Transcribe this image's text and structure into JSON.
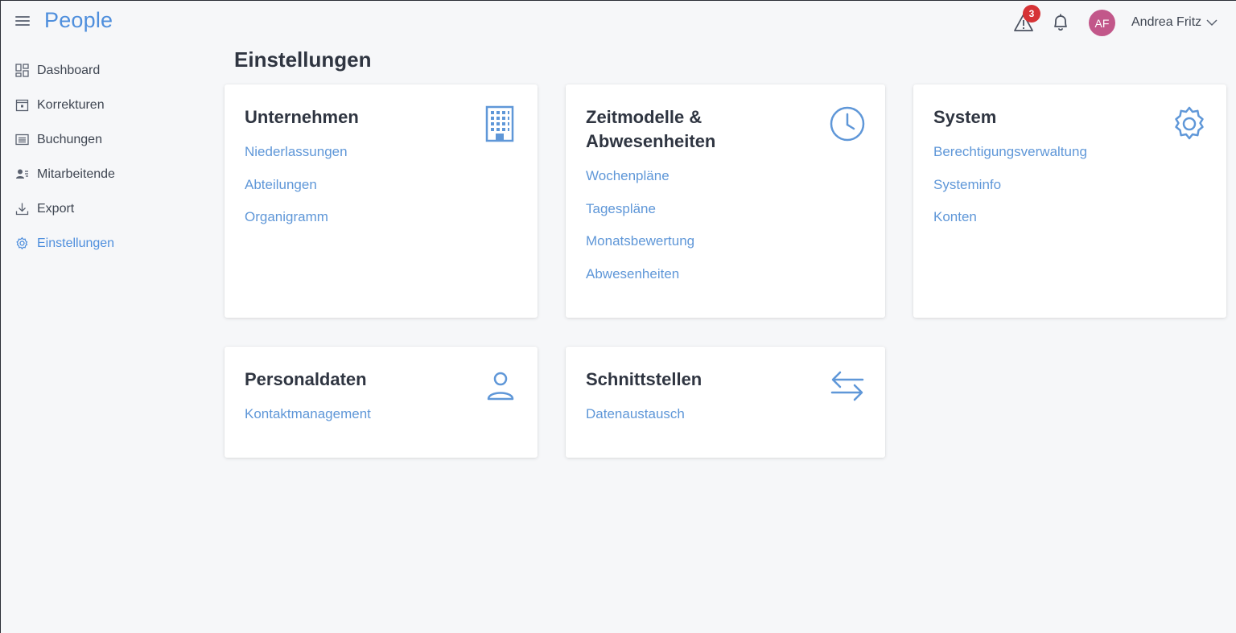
{
  "app": {
    "brand": "People"
  },
  "header": {
    "alert_count": "3",
    "avatar_initials": "AF",
    "user_name": "Andrea Fritz",
    "avatar_color": "#c2578a",
    "badge_color": "#d63336"
  },
  "sidebar": {
    "items": [
      {
        "label": "Dashboard",
        "icon": "dashboard-icon"
      },
      {
        "label": "Korrekturen",
        "icon": "calendar-icon"
      },
      {
        "label": "Buchungen",
        "icon": "list-icon"
      },
      {
        "label": "Mitarbeitende",
        "icon": "users-icon"
      },
      {
        "label": "Export",
        "icon": "download-icon"
      },
      {
        "label": "Einstellungen",
        "icon": "gear-icon",
        "active": true
      }
    ]
  },
  "main": {
    "title": "Einstellungen",
    "cards": [
      {
        "title": "Unternehmen",
        "icon": "building-icon",
        "links": [
          "Niederlassungen",
          "Abteilungen",
          "Organigramm"
        ]
      },
      {
        "title": "Zeitmodelle & Abwesenheiten",
        "icon": "clock-icon",
        "links": [
          "Wochenpläne",
          "Tagespläne",
          "Monatsbewertung",
          "Abwesenheiten"
        ]
      },
      {
        "title": "System",
        "icon": "gear-icon",
        "links": [
          "Berechtigungsverwaltung",
          "Systeminfo",
          "Konten"
        ]
      },
      {
        "title": "Personaldaten",
        "icon": "person-icon",
        "links": [
          "Kontaktmanagement"
        ]
      },
      {
        "title": "Schnittstellen",
        "icon": "arrows-exchange-icon",
        "links": [
          "Datenaustausch"
        ]
      }
    ]
  },
  "colors": {
    "accent": "#4f8fdd",
    "link": "#5f97d8",
    "background": "#f6f7f9"
  }
}
